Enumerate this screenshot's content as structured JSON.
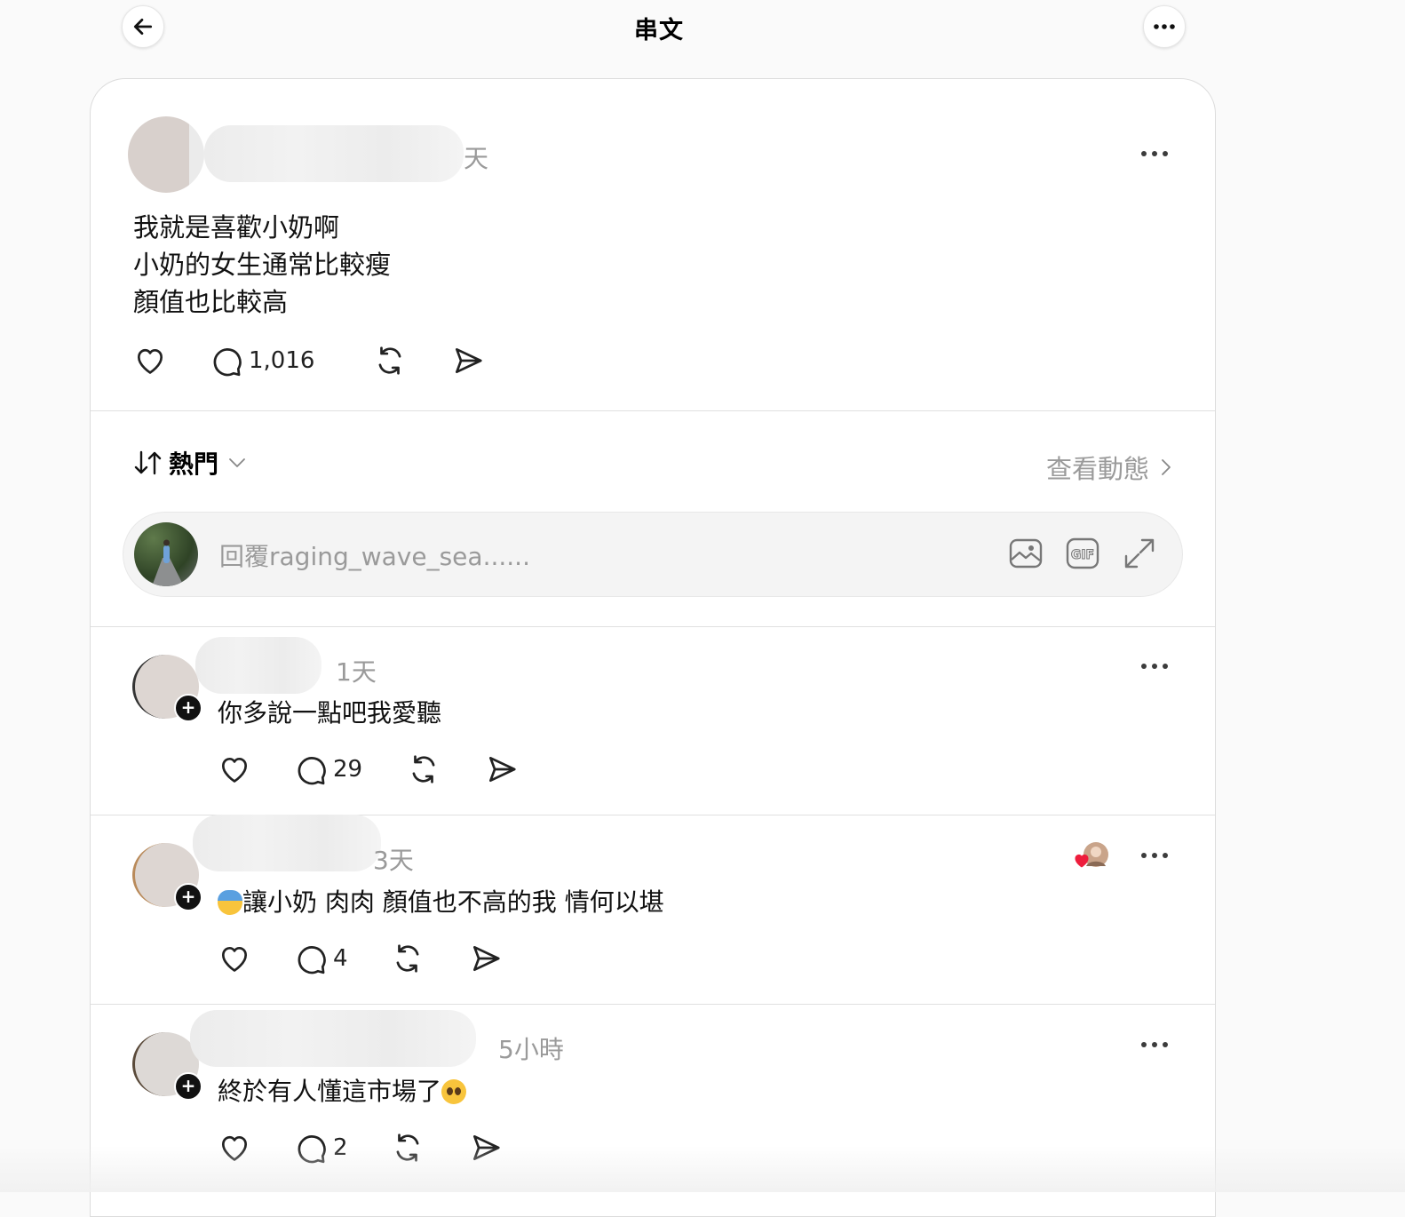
{
  "header": {
    "title": "串文"
  },
  "post": {
    "time": "天",
    "lines": [
      "我就是喜歡小奶啊",
      "小奶的女生通常比較瘦",
      "顏值也比較高"
    ],
    "reply_count": "1,016"
  },
  "sort": {
    "label": "熱門"
  },
  "activity": {
    "label": "查看動態"
  },
  "reply_box": {
    "placeholder": "回覆raging_wave_sea......"
  },
  "comments": [
    {
      "time": "1天",
      "text": "你多說一點吧我愛聽",
      "reply_count": "29"
    },
    {
      "time": "3天",
      "text": "讓小奶 肉肉 顏值也不高的我 情何以堪",
      "reply_count": "4"
    },
    {
      "time": "5小時",
      "text": "終於有人懂這市場了",
      "reply_count": "2"
    }
  ],
  "colors": {
    "accent_heart": "#ee1d3c",
    "muted_text": "#9a9a9a"
  }
}
